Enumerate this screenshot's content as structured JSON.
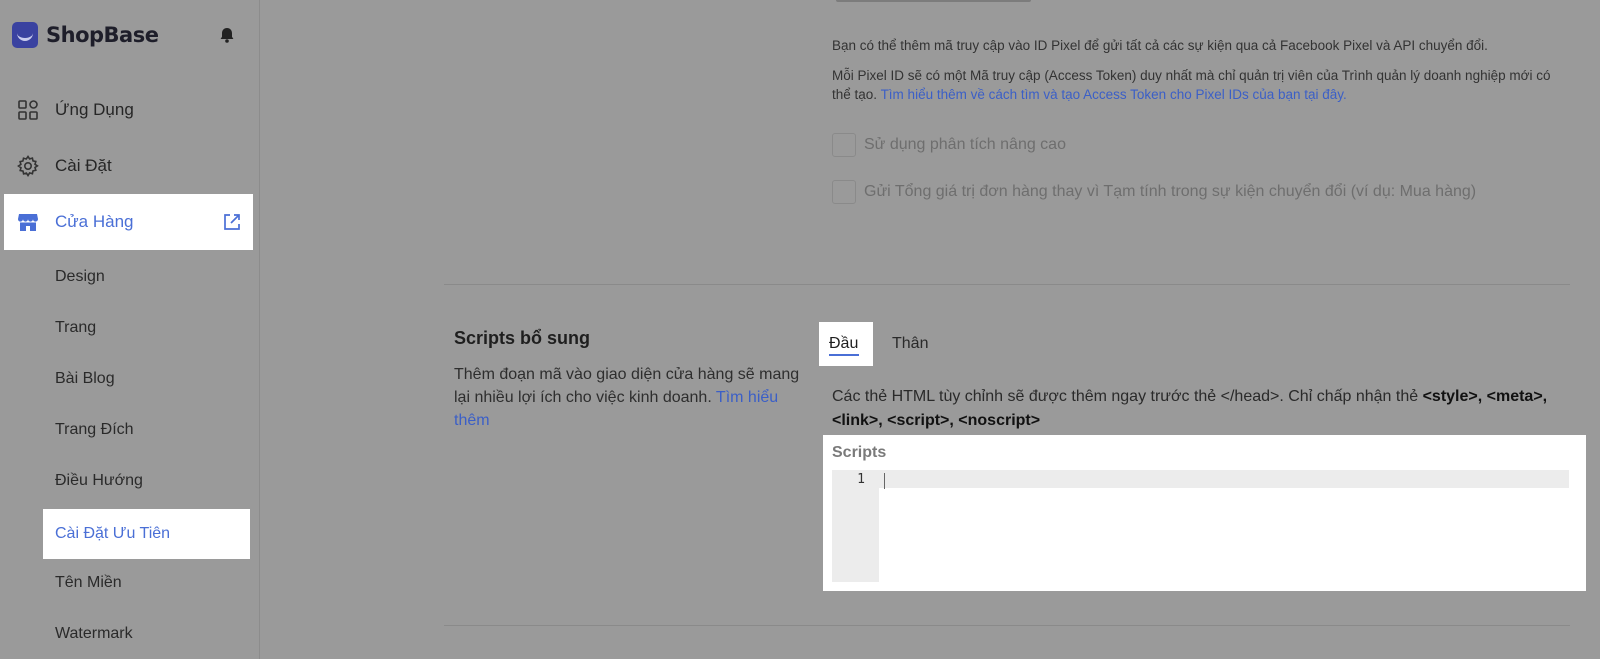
{
  "app": {
    "brand": "ShopBase"
  },
  "sidebar": {
    "items": [
      {
        "label": "Ứng Dụng",
        "icon": "grid-icon"
      },
      {
        "label": "Cài Đặt",
        "icon": "gear-icon"
      },
      {
        "label": "Cửa Hàng",
        "icon": "store-icon",
        "active": true
      }
    ],
    "sub_items": [
      {
        "label": "Design"
      },
      {
        "label": "Trang"
      },
      {
        "label": "Bài Blog"
      },
      {
        "label": "Trang Đích"
      },
      {
        "label": "Điều Hướng"
      },
      {
        "label": "Cài Đặt Ưu Tiên",
        "active": true
      },
      {
        "label": "Tên Miền"
      },
      {
        "label": "Watermark"
      }
    ]
  },
  "pixel": {
    "info1": "Bạn có thể thêm mã truy cập vào ID Pixel để gửi tất cả các sự kiện qua cả Facebook Pixel và API chuyển đổi.",
    "info2": "Mỗi Pixel ID sẽ có một Mã truy cập (Access Token) duy nhất mà chỉ quản trị viên của Trình quản lý doanh nghiệp mới có thể tạo.",
    "info2_link": "Tìm hiểu thêm về cách tìm và tạo Access Token cho Pixel IDs của bạn tại đây.",
    "checkbox_advanced": "Sử dụng phân tích nâng cao",
    "checkbox_total": "Gửi Tổng giá trị đơn hàng thay vì Tạm tính trong sự kiện chuyển đổi (ví dụ: Mua hàng)"
  },
  "scripts": {
    "title": "Scripts bổ sung",
    "desc": "Thêm đoạn mã vào giao diện cửa hàng sẽ mang lại nhiều lợi ích cho việc kinh doanh.",
    "desc_link": "Tìm hiểu thêm",
    "tabs": [
      {
        "label": "Đầu",
        "active": true
      },
      {
        "label": "Thân"
      }
    ],
    "note_prefix": "Các thẻ HTML tùy chỉnh sẽ được thêm ngay trước thẻ </head>. Chỉ chấp nhận thẻ",
    "note_tags": "<style>, <meta>, <link>, <script>, <noscript>",
    "editor_label": "Scripts",
    "line_number": "1"
  },
  "colors": {
    "accent": "#4a6fd6",
    "link": "#3b5fc7",
    "overlay": "#9a9a9a"
  }
}
